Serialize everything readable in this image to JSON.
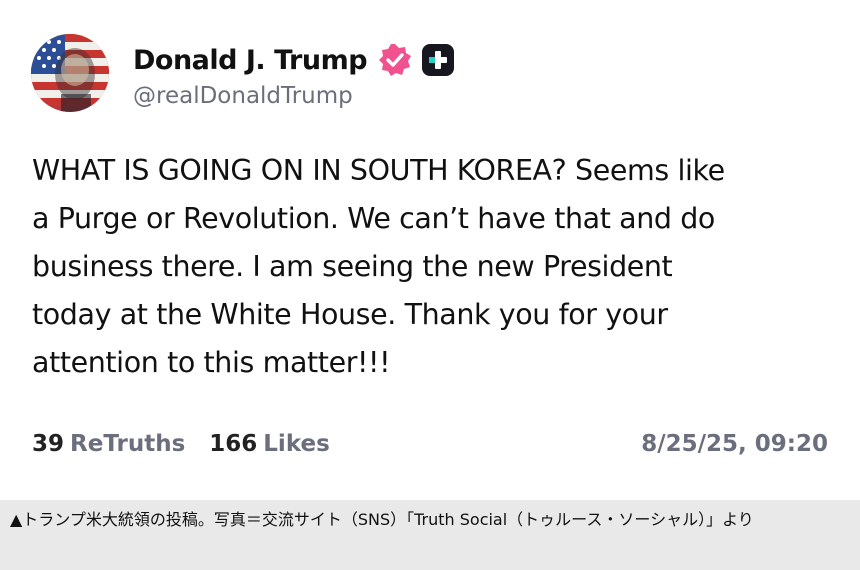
{
  "post": {
    "author": {
      "display_name": "Donald J. Trump",
      "handle": "@realDonaldTrump",
      "avatar_icon": "avatar-flag-portrait",
      "verified_icon": "verified-badge-icon",
      "plus_icon": "plus-badge-icon"
    },
    "body_lines": [
      "WHAT IS GOING ON IN SOUTH KOREA? Seems like",
      "a Purge or Revolution. We can’t have that and do",
      "business there. I am seeing the new President",
      "today at the White House. Thank you for your",
      "attention to this matter!!!"
    ],
    "stats": {
      "retruths_count": "39",
      "retruths_label": "ReTruths",
      "likes_count": "166",
      "likes_label": "Likes"
    },
    "timestamp": "8/25/25, 09:20"
  },
  "caption": {
    "text": "▲トランプ米大統領の投稿。写真＝交流サイト（SNS）「Truth Social（トゥルース・ソーシャル）」より"
  },
  "colors": {
    "verified_pink": "#f0518f",
    "muted_gray": "#6b6e7d",
    "caption_bg": "#e9e9e9",
    "plus_teal": "#25d1c4"
  }
}
